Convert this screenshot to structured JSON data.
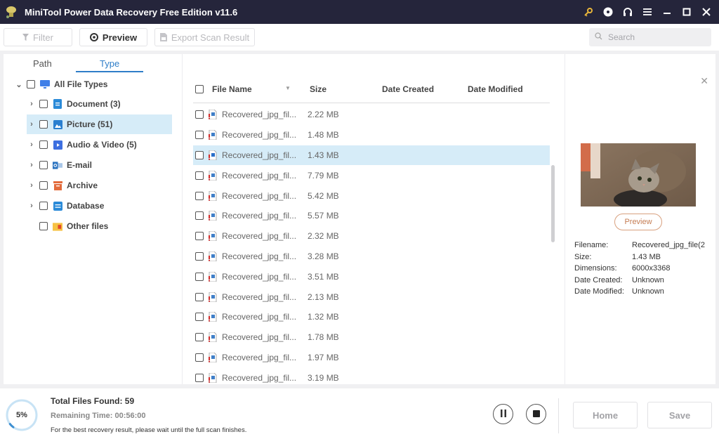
{
  "window": {
    "title": "MiniTool Power Data Recovery Free Edition v11.6",
    "controls": [
      "key-icon",
      "disc-icon",
      "headset-icon",
      "menu-icon",
      "minimize-icon",
      "maximize-icon",
      "close-icon"
    ]
  },
  "toolbar": {
    "filter_label": "Filter",
    "preview_label": "Preview",
    "export_label": "Export Scan Result",
    "search_placeholder": "Search"
  },
  "tabs": [
    {
      "label": "Path",
      "active": false
    },
    {
      "label": "Type",
      "active": true
    }
  ],
  "tree": {
    "root": {
      "label": "All File Types",
      "expanded": true
    },
    "items": [
      {
        "label": "Document (3)",
        "icon": "document-icon",
        "expandable": true,
        "selected": false
      },
      {
        "label": "Picture (51)",
        "icon": "picture-icon",
        "expandable": true,
        "selected": true
      },
      {
        "label": "Audio & Video (5)",
        "icon": "audio-video-icon",
        "expandable": true,
        "selected": false
      },
      {
        "label": "E-mail",
        "icon": "email-icon",
        "expandable": true,
        "selected": false
      },
      {
        "label": "Archive",
        "icon": "archive-icon",
        "expandable": true,
        "selected": false
      },
      {
        "label": "Database",
        "icon": "database-icon",
        "expandable": true,
        "selected": false
      },
      {
        "label": "Other files",
        "icon": "folder-icon",
        "expandable": false,
        "selected": false
      }
    ]
  },
  "file_list": {
    "columns": [
      "File Name",
      "Size",
      "Date Created",
      "Date Modified"
    ],
    "rows": [
      {
        "name": "Recovered_jpg_fil...",
        "size": "2.22 MB",
        "selected": false
      },
      {
        "name": "Recovered_jpg_fil...",
        "size": "1.48 MB",
        "selected": false
      },
      {
        "name": "Recovered_jpg_fil...",
        "size": "1.43 MB",
        "selected": true
      },
      {
        "name": "Recovered_jpg_fil...",
        "size": "7.79 MB",
        "selected": false
      },
      {
        "name": "Recovered_jpg_fil...",
        "size": "5.42 MB",
        "selected": false
      },
      {
        "name": "Recovered_jpg_fil...",
        "size": "5.57 MB",
        "selected": false
      },
      {
        "name": "Recovered_jpg_fil...",
        "size": "2.32 MB",
        "selected": false
      },
      {
        "name": "Recovered_jpg_fil...",
        "size": "3.28 MB",
        "selected": false
      },
      {
        "name": "Recovered_jpg_fil...",
        "size": "3.51 MB",
        "selected": false
      },
      {
        "name": "Recovered_jpg_fil...",
        "size": "2.13 MB",
        "selected": false
      },
      {
        "name": "Recovered_jpg_fil...",
        "size": "1.32 MB",
        "selected": false
      },
      {
        "name": "Recovered_jpg_fil...",
        "size": "1.78 MB",
        "selected": false
      },
      {
        "name": "Recovered_jpg_fil...",
        "size": "1.97 MB",
        "selected": false
      },
      {
        "name": "Recovered_jpg_fil...",
        "size": "3.19 MB",
        "selected": false
      }
    ]
  },
  "preview": {
    "button_label": "Preview",
    "meta": [
      {
        "key": "Filename:",
        "value": "Recovered_jpg_file(2"
      },
      {
        "key": "Size:",
        "value": "1.43 MB"
      },
      {
        "key": "Dimensions:",
        "value": "6000x3368"
      },
      {
        "key": "Date Created:",
        "value": "Unknown"
      },
      {
        "key": "Date Modified:",
        "value": "Unknown"
      }
    ]
  },
  "footer": {
    "progress_percent": 5,
    "progress_label": "5%",
    "total_files_label": "Total Files Found:",
    "total_files_value": "59",
    "remaining_label": "Remaining Time:",
    "remaining_value": "00:56:00",
    "hint": "For the best recovery result, please wait until the full scan finishes.",
    "home_label": "Home",
    "save_label": "Save"
  },
  "colors": {
    "titlebar": "#25253b",
    "accent": "#2f7ec8",
    "selection": "#d6ecf8",
    "preview_button": "#c57d53",
    "progress_ring": "#c8e3f5",
    "progress_fill": "#3d8fd1"
  }
}
